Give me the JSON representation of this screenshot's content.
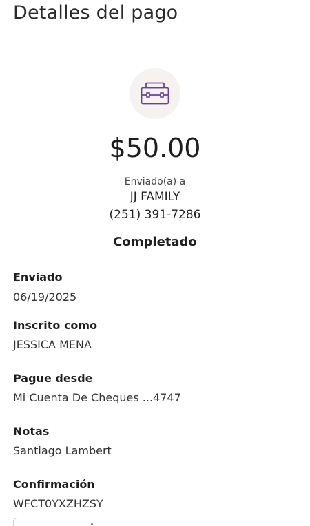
{
  "header": {
    "title": "Detalles del pago"
  },
  "icon": {
    "name": "briefcase-icon",
    "color": "#6b3fa0",
    "background": "#f5f2ef"
  },
  "payment": {
    "amount": "$50.00",
    "sent_to_label": "Enviado(a) a",
    "recipient": "JJ FAMILY",
    "phone": "(251) 391-7286",
    "status": "Completado"
  },
  "details": [
    {
      "label": "Enviado",
      "value": "06/19/2025"
    },
    {
      "label": "Inscrito como",
      "value": "JESSICA MENA"
    },
    {
      "label": "Pague desde",
      "value": "Mi Cuenta De Cheques ...4747"
    },
    {
      "label": "Notas",
      "value": "Santiago Lambert"
    },
    {
      "label": "Confirmación",
      "value": "WFCT0YXZHZSY"
    }
  ]
}
